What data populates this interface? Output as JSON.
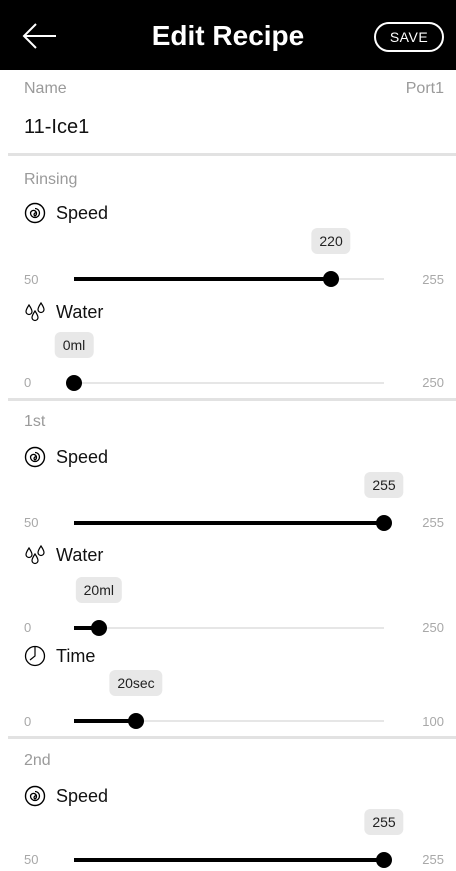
{
  "header": {
    "title": "Edit Recipe",
    "save_label": "SAVE"
  },
  "name_section": {
    "label": "Name",
    "port": "Port1",
    "value": "11-Ice1"
  },
  "sections": [
    {
      "title": "Rinsing",
      "params": [
        {
          "label": "Speed",
          "icon": "spiral-icon",
          "min": "50",
          "max": "255",
          "value": 220,
          "display": "220"
        },
        {
          "label": "Water",
          "icon": "water-drops-icon",
          "min": "0",
          "max": "250",
          "value": 0,
          "display": "0ml"
        }
      ]
    },
    {
      "title": "1st",
      "params": [
        {
          "label": "Speed",
          "icon": "spiral-icon",
          "min": "50",
          "max": "255",
          "value": 255,
          "display": "255"
        },
        {
          "label": "Water",
          "icon": "water-drops-icon",
          "min": "0",
          "max": "250",
          "value": 20,
          "display": "20ml"
        },
        {
          "label": "Time",
          "icon": "timer-icon",
          "min": "0",
          "max": "100",
          "value": 20,
          "display": "20sec"
        }
      ]
    },
    {
      "title": "2nd",
      "params": [
        {
          "label": "Speed",
          "icon": "spiral-icon",
          "min": "50",
          "max": "255",
          "value": 255,
          "display": "255"
        }
      ]
    }
  ]
}
